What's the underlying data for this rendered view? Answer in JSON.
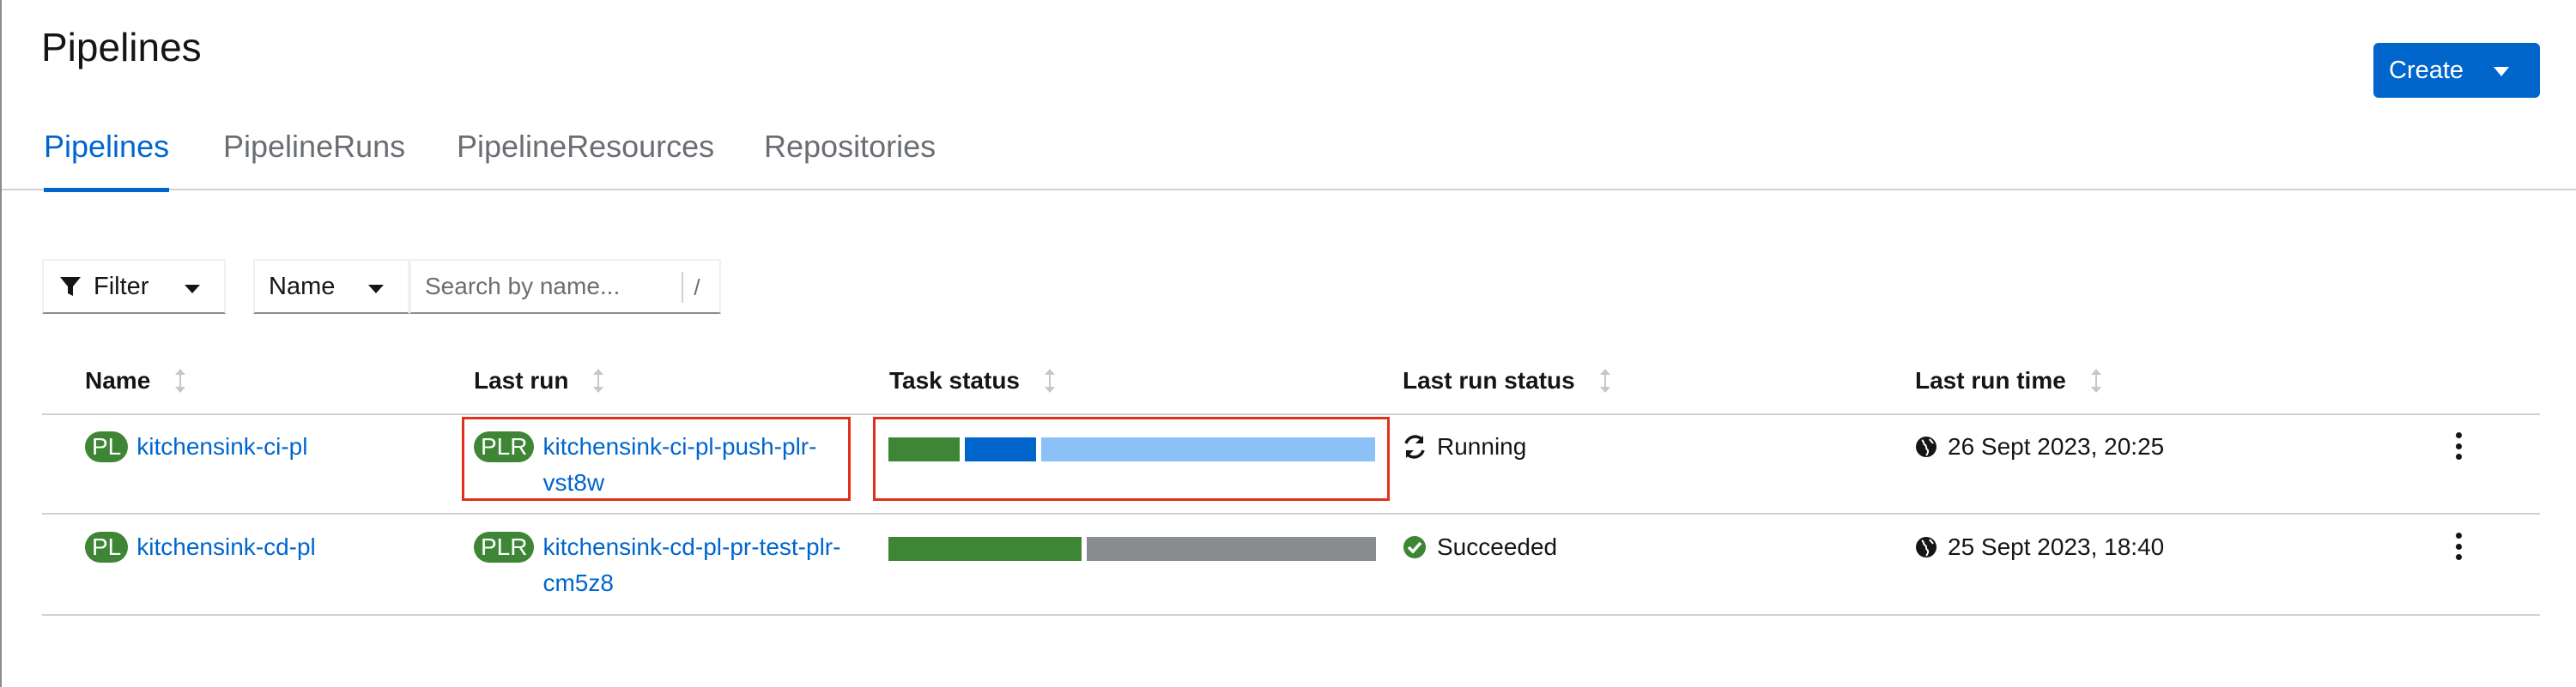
{
  "page": {
    "title": "Pipelines"
  },
  "create_button": {
    "label": "Create"
  },
  "tabs": [
    {
      "label": "Pipelines",
      "active": true
    },
    {
      "label": "PipelineRuns",
      "active": false
    },
    {
      "label": "PipelineResources",
      "active": false
    },
    {
      "label": "Repositories",
      "active": false
    }
  ],
  "toolbar": {
    "filter_label": "Filter",
    "name_select": "Name",
    "search_placeholder": "Search by name...",
    "search_shortcut": "/"
  },
  "table": {
    "columns": [
      "Name",
      "Last run",
      "Task status",
      "Last run status",
      "Last run time"
    ],
    "rows": [
      {
        "badge": "PL",
        "name": "kitchensink-ci-pl",
        "run_badge": "PLR",
        "last_run_line1": "kitchensink-ci-pl-push-plr-",
        "last_run_line2": "vst8w",
        "task_status": [
          {
            "state": "succeeded",
            "fraction": 0.15,
            "color": "#3e8635"
          },
          {
            "state": "running",
            "fraction": 0.15,
            "color": "#0066cc"
          },
          {
            "state": "pending",
            "fraction": 0.7,
            "color": "#8bc1f7"
          }
        ],
        "status_icon": "sync-icon",
        "status": "Running",
        "time_icon": "globe-icon",
        "time": "26 Sept 2023, 20:25"
      },
      {
        "badge": "PL",
        "name": "kitchensink-cd-pl",
        "run_badge": "PLR",
        "last_run_line1": "kitchensink-cd-pl-pr-test-plr-",
        "last_run_line2": "cm5z8",
        "task_status": [
          {
            "state": "succeeded",
            "fraction": 0.4,
            "color": "#3e8635"
          },
          {
            "state": "skipped",
            "fraction": 0.6,
            "color": "#8a8d90"
          }
        ],
        "status_icon": "check-circle-icon",
        "status": "Succeeded",
        "time_icon": "globe-icon",
        "time": "25 Sept 2023, 18:40"
      }
    ]
  },
  "colors": {
    "accent": "#0066cc",
    "success": "#3e8635",
    "highlight": "#e0301e"
  }
}
